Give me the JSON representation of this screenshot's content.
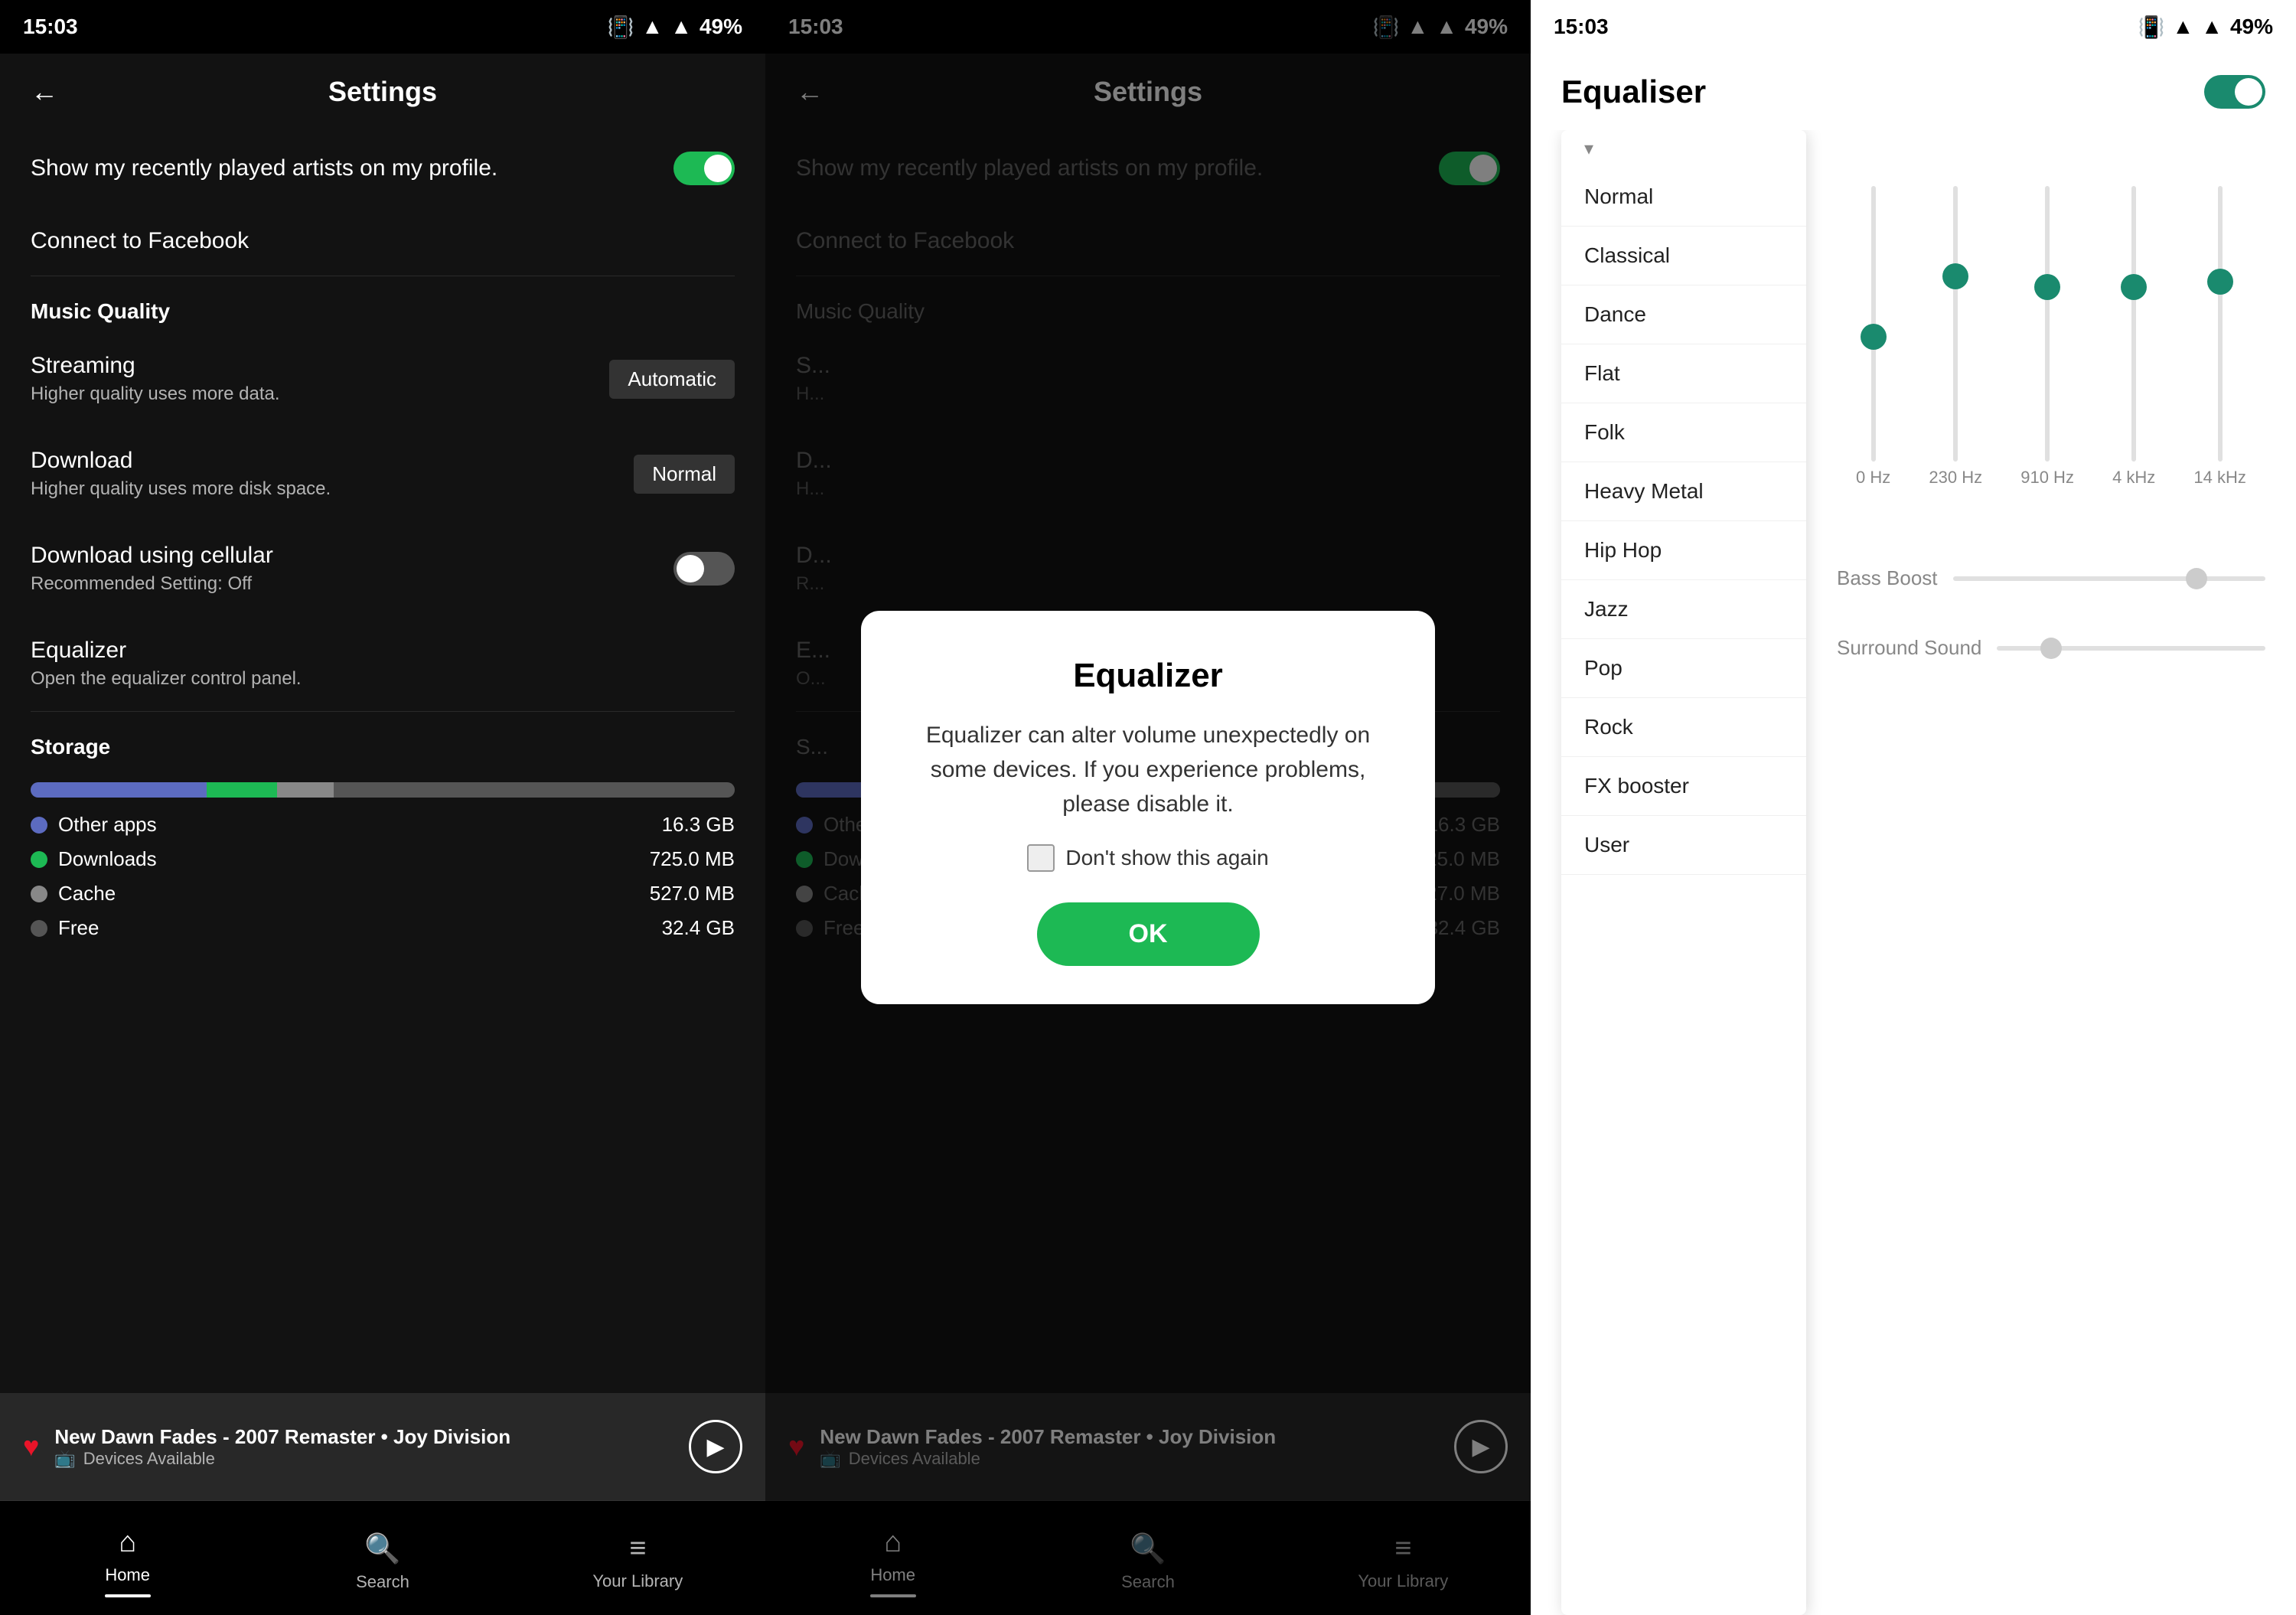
{
  "status": {
    "time": "15:03",
    "battery": "49%"
  },
  "panel1": {
    "title": "Settings",
    "back": "←",
    "profile_toggle_label": "Show my recently played artists on my profile.",
    "facebook_label": "Connect to Facebook",
    "music_quality_header": "Music Quality",
    "streaming_label": "Streaming",
    "streaming_sub": "Higher quality uses more data.",
    "streaming_value": "Automatic",
    "download_label": "Download",
    "download_sub": "Higher quality uses more disk space.",
    "download_value": "Normal",
    "cellular_label": "Download using cellular",
    "cellular_sub": "Recommended Setting: Off",
    "equalizer_label": "Equalizer",
    "equalizer_sub": "Open the equalizer control panel.",
    "storage_header": "Storage",
    "storage_segments": [
      {
        "color": "#5c6bc0",
        "pct": 25
      },
      {
        "color": "#1db954",
        "pct": 10
      },
      {
        "color": "#888",
        "pct": 8
      },
      {
        "color": "#555",
        "pct": 57
      }
    ],
    "storage_items": [
      {
        "color": "#5c6bc0",
        "label": "Other apps",
        "value": "16.3 GB"
      },
      {
        "color": "#1db954",
        "label": "Downloads",
        "value": "725.0 MB"
      },
      {
        "color": "#888",
        "label": "Cache",
        "value": "527.0 MB"
      },
      {
        "color": "#555",
        "label": "Free",
        "value": "32.4 GB"
      }
    ],
    "now_playing_title": "New Dawn Fades - 2007 Remaster • Joy Division",
    "now_playing_sub": "Devices Available",
    "nav_home": "Home",
    "nav_search": "Search",
    "nav_library": "Your Library"
  },
  "panel2": {
    "title": "Settings",
    "back": "←",
    "modal": {
      "title": "Equalizer",
      "body": "Equalizer can alter volume unexpectedly on some devices. If you experience problems, please disable it.",
      "checkbox_label": "Don't show this again",
      "ok_label": "OK"
    },
    "storage_items": [
      {
        "color": "#5c6bc0",
        "label": "Other apps",
        "value": "16.3 GB"
      },
      {
        "color": "#1db954",
        "label": "Downloads",
        "value": "725.0 MB"
      },
      {
        "color": "#888",
        "label": "Cache",
        "value": "527.0 MB"
      },
      {
        "color": "#555",
        "label": "Free",
        "value": "32.4 GB"
      }
    ],
    "now_playing_title": "New Dawn Fades - 2007 Remaster • Joy Division",
    "now_playing_sub": "Devices Available",
    "nav_home": "Home",
    "nav_search": "Search",
    "nav_library": "Your Library"
  },
  "panel3": {
    "title": "Equaliser",
    "toggle_on": true,
    "dropdown_items": [
      "Normal",
      "Classical",
      "Dance",
      "Flat",
      "Folk",
      "Heavy Metal",
      "Hip Hop",
      "Jazz",
      "Pop",
      "Rock",
      "FX booster",
      "User"
    ],
    "freq_labels": [
      "0 Hz",
      "230 Hz",
      "910 Hz",
      "4 kHz",
      "14 kHz"
    ],
    "slider_positions": [
      50,
      30,
      35,
      35,
      32
    ],
    "bass_label": "Bass Boost",
    "surroud_label": "Surround Sound",
    "bass_value": 80,
    "surround_value": 20
  }
}
